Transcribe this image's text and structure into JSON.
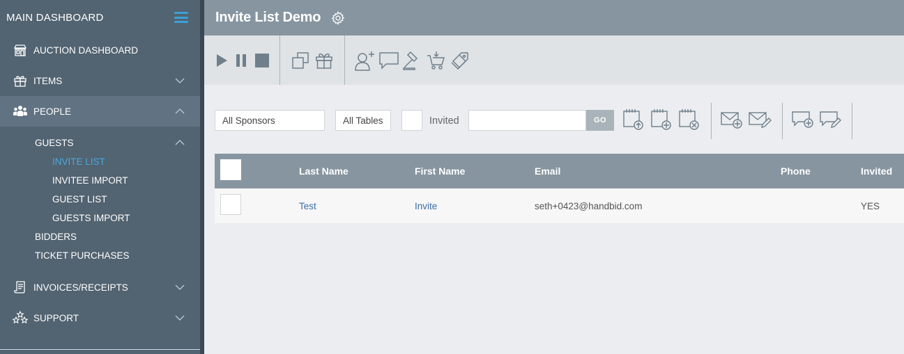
{
  "sidebar": {
    "header": "MAIN DASHBOARD",
    "items": [
      {
        "label": "AUCTION DASHBOARD",
        "icon": "storefront-icon"
      },
      {
        "label": "ITEMS",
        "icon": "gift-icon"
      },
      {
        "label": "PEOPLE",
        "icon": "people-icon"
      },
      {
        "label": "INVOICES/RECEIPTS",
        "icon": "receipt-icon"
      },
      {
        "label": "SUPPORT",
        "icon": "stars-icon"
      }
    ],
    "people_sub": {
      "guests": "GUESTS",
      "guests_children": [
        "INVITE LIST",
        "INVITEE IMPORT",
        "GUEST LIST",
        "GUESTS IMPORT"
      ],
      "bidders": "BIDDERS",
      "ticket_purchases": "TICKET PURCHASES"
    }
  },
  "header": {
    "title": "Invite List Demo"
  },
  "filters": {
    "sponsors": "All Sponsors",
    "tables": "All Tables",
    "invited_label": "Invited",
    "search_value": "",
    "go_label": "GO"
  },
  "table": {
    "columns": [
      "Last Name",
      "First Name",
      "Email",
      "Phone",
      "Invited"
    ],
    "rows": [
      {
        "last": "Test",
        "first": "Invite",
        "email": "seth+0423@handbid.com",
        "phone": "",
        "invited": "YES"
      }
    ]
  },
  "colors": {
    "sidebar_bg": "#526371",
    "sidebar_active": "#617282",
    "accent": "#3aa2d8",
    "header_bg": "#8795a0",
    "toolbar_bg": "#dfe3e6",
    "link": "#3b6ea5"
  }
}
